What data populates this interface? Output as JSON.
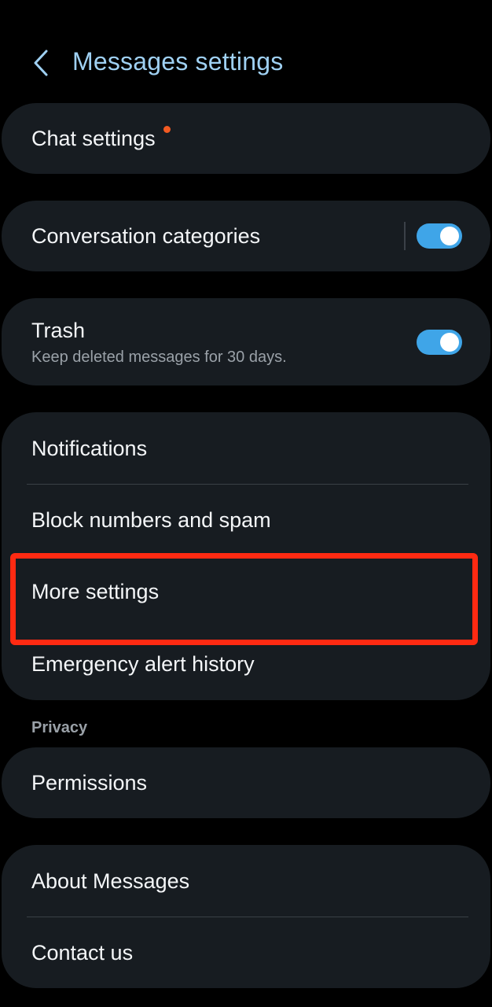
{
  "colors": {
    "background": "#000000",
    "card": "#171c21",
    "title": "#9fd0f2",
    "accent": "#3fa5e8",
    "badge": "#f25a22",
    "highlight": "#ff2a12",
    "subtext": "#9aa1a8"
  },
  "header": {
    "back_icon": "chevron-left-icon",
    "title": "Messages settings"
  },
  "items": {
    "chat_settings": {
      "label": "Chat settings",
      "has_badge": true
    },
    "conversation_categories": {
      "label": "Conversation categories",
      "toggle": "on"
    },
    "trash": {
      "label": "Trash",
      "subtitle": "Keep deleted messages for 30 days.",
      "toggle": "on"
    },
    "notifications": {
      "label": "Notifications"
    },
    "block_numbers": {
      "label": "Block numbers and spam"
    },
    "more_settings": {
      "label": "More settings",
      "highlighted": true
    },
    "emergency_alert_history": {
      "label": "Emergency alert history"
    },
    "privacy_section": {
      "label": "Privacy"
    },
    "permissions": {
      "label": "Permissions"
    },
    "about_messages": {
      "label": "About Messages"
    },
    "contact_us": {
      "label": "Contact us"
    }
  }
}
